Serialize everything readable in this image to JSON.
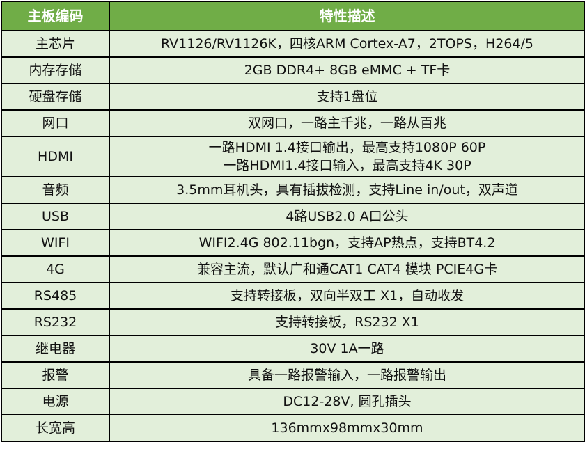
{
  "header": {
    "col1": "主板编码",
    "col2": "特性描述"
  },
  "rows": [
    {
      "label": "主芯片",
      "lines": [
        "RV1126/RV1126K，四核ARM Cortex-A7，2TOPS，H264/5"
      ]
    },
    {
      "label": "内存存储",
      "lines": [
        "2GB DDR4+ 8GB eMMC + TF卡"
      ]
    },
    {
      "label": "硬盘存储",
      "lines": [
        "支持1盘位"
      ]
    },
    {
      "label": "网口",
      "lines": [
        "双网口，一路主千兆，一路从百兆"
      ]
    },
    {
      "label": "HDMI",
      "lines": [
        "一路HDMI 1.4接口输出，最高支持1080P 60P",
        "一路HDMI1.4接口输入，最高支持4K 30P"
      ]
    },
    {
      "label": "音频",
      "lines": [
        "3.5mm耳机头，具有插拔检测，支持Line in/out，双声道"
      ]
    },
    {
      "label": "USB",
      "lines": [
        "4路USB2.0 A口公头"
      ]
    },
    {
      "label": "WIFI",
      "lines": [
        "WIFI2.4G 802.11bgn，支持AP热点，支持BT4.2"
      ]
    },
    {
      "label": "4G",
      "lines": [
        "兼容主流，默认广和通CAT1 CAT4 模块 PCIE4G卡"
      ]
    },
    {
      "label": "RS485",
      "lines": [
        "支持转接板，双向半双工 X1，自动收发"
      ]
    },
    {
      "label": "RS232",
      "lines": [
        "支持转接板，RS232 X1"
      ]
    },
    {
      "label": "继电器",
      "lines": [
        "30V 1A一路"
      ]
    },
    {
      "label": "报警",
      "lines": [
        "具备一路报警输入，一路报警输出"
      ]
    },
    {
      "label": "电源",
      "lines": [
        "DC12-28V, 圆孔插头"
      ]
    },
    {
      "label": "长宽高",
      "lines": [
        "136mmx98mmx30mm"
      ]
    }
  ],
  "colors": {
    "header_bg": "#70ad47",
    "header_text": "#ffffff",
    "row_bg": "#e2efda",
    "border": "#000000"
  }
}
